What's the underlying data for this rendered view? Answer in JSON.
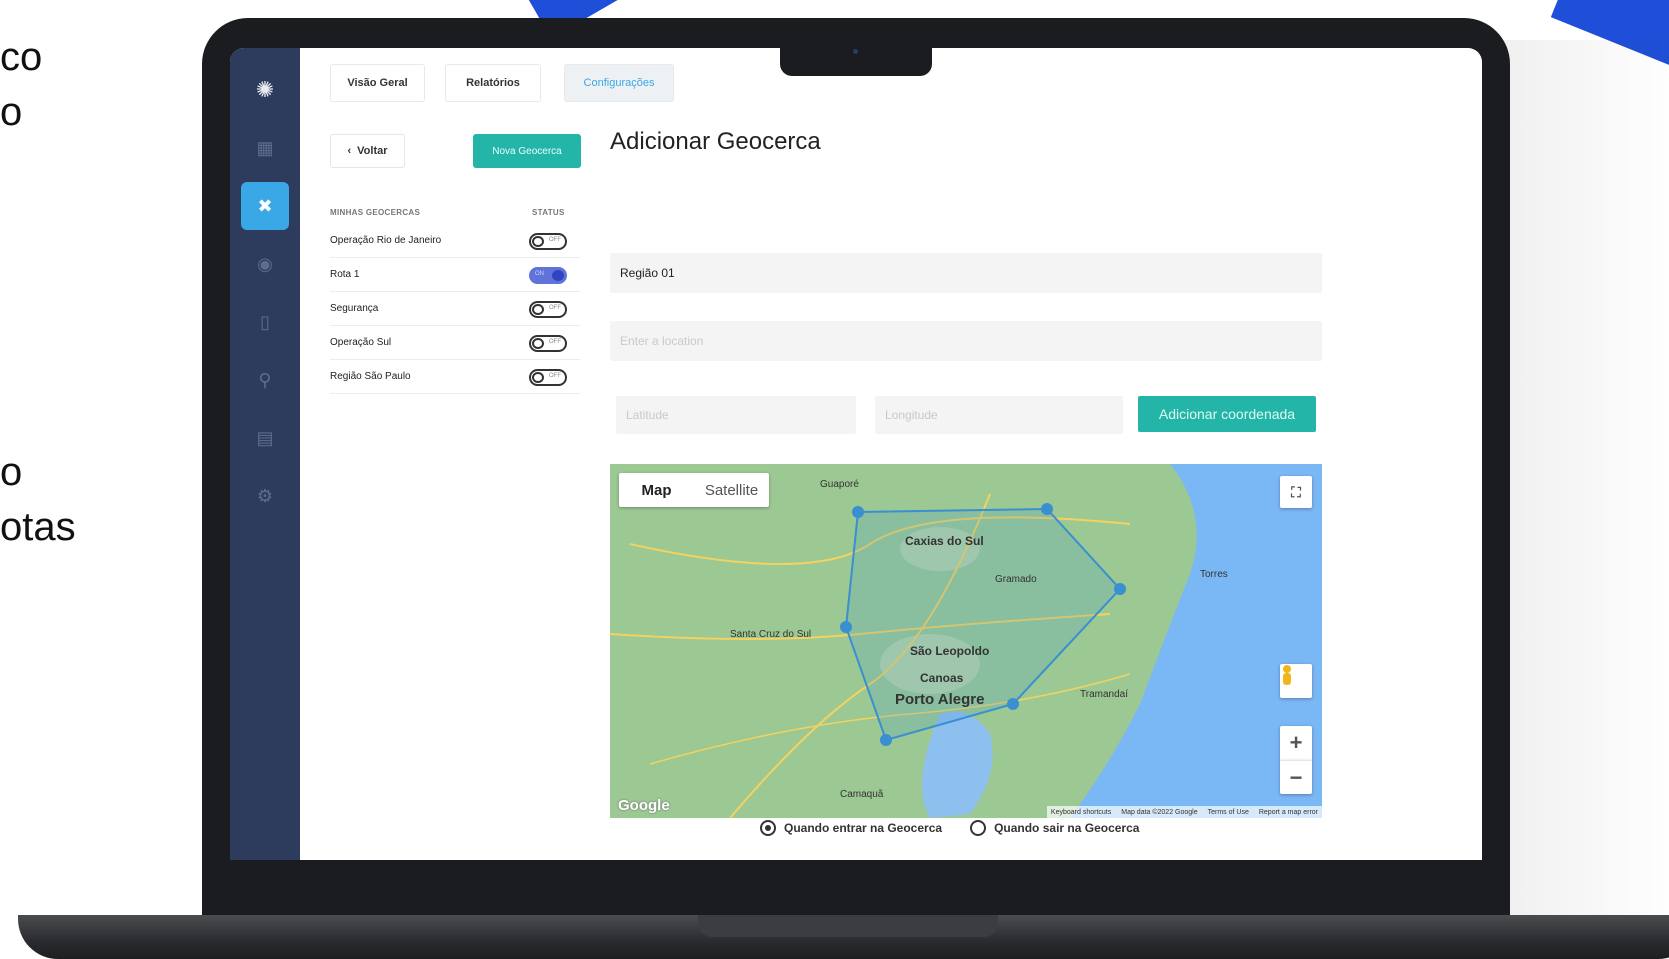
{
  "side_text": {
    "block1": [
      "co",
      "o"
    ],
    "block2": [
      "o",
      "otas"
    ]
  },
  "sidebar": {
    "icons": [
      "logo-icon",
      "grid-icon",
      "tools-icon",
      "circle-icon",
      "document-icon",
      "search-user-icon",
      "report-icon",
      "settings-icon"
    ]
  },
  "tabs": [
    {
      "label": "Visão Geral",
      "active": false
    },
    {
      "label": "Relatórios",
      "active": false
    },
    {
      "label": "Configurações",
      "active": true
    }
  ],
  "back_button": "Voltar",
  "new_button": "Nova Geocerca",
  "list": {
    "header_name": "MINHAS GEOCERCAS",
    "header_status": "STATUS",
    "items": [
      {
        "name": "Operação Rio de Janeiro",
        "on": false,
        "toggle_label": "OFF"
      },
      {
        "name": "Rota 1",
        "on": true,
        "toggle_label": "ON"
      },
      {
        "name": "Segurança",
        "on": false,
        "toggle_label": "OFF"
      },
      {
        "name": "Operação Sul",
        "on": false,
        "toggle_label": "OFF"
      },
      {
        "name": "Região São Paulo",
        "on": false,
        "toggle_label": "OFF"
      }
    ]
  },
  "form": {
    "title": "Adicionar Geocerca",
    "region_value": "Região 01",
    "location_placeholder": "Enter a location",
    "latitude_placeholder": "Latitude",
    "longitude_placeholder": "Longitude",
    "add_button": "Adicionar coordenada"
  },
  "map": {
    "map_tab": "Map",
    "satellite_tab": "Satellite",
    "zoom_in": "+",
    "zoom_out": "−",
    "fullscreen": "⛶",
    "google": "Google",
    "footer": [
      "Keyboard shortcuts",
      "Map data ©2022 Google",
      "Terms of Use",
      "Report a map error"
    ],
    "labels": [
      {
        "text": "Caxias do Sul",
        "big": false
      },
      {
        "text": "São Leopoldo",
        "big": false
      },
      {
        "text": "Canoas",
        "big": false
      },
      {
        "text": "Porto Alegre",
        "big": true
      },
      {
        "text": "Gramado",
        "big": false
      },
      {
        "text": "Santa Cruz do Sul",
        "big": false
      },
      {
        "text": "Tramandaí",
        "big": false
      },
      {
        "text": "Guaporé",
        "big": false
      },
      {
        "text": "Torres",
        "big": false
      },
      {
        "text": "Camaquã",
        "big": false
      }
    ],
    "colors": {
      "land": "#9cc893",
      "water": "#7ab7f5",
      "polygon": "#3a8fd0"
    }
  },
  "radios": [
    {
      "label": "Quando entrar na Geocerca",
      "checked": true
    },
    {
      "label": "Quando sair na Geocerca",
      "checked": false
    }
  ]
}
